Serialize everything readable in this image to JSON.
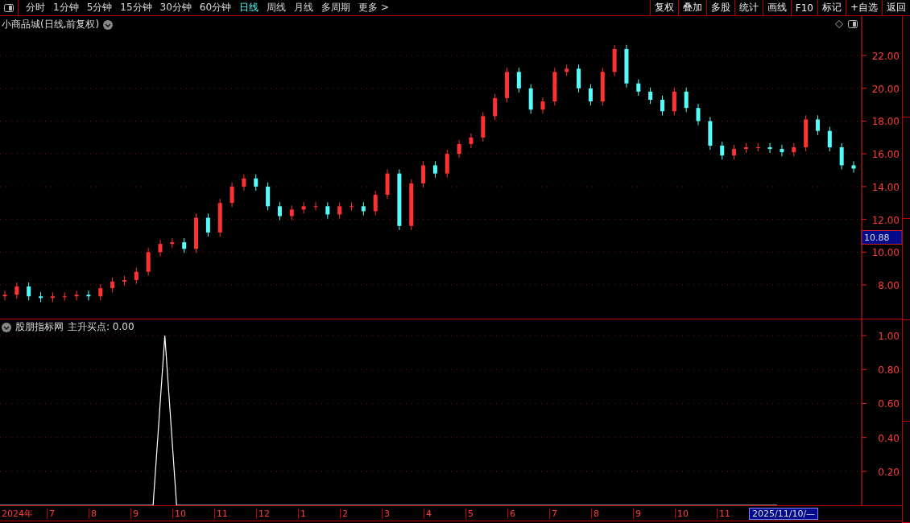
{
  "toolbar": {
    "periods": [
      {
        "label": "分时",
        "selected": false
      },
      {
        "label": "1分钟",
        "selected": false
      },
      {
        "label": "5分钟",
        "selected": false
      },
      {
        "label": "15分钟",
        "selected": false
      },
      {
        "label": "30分钟",
        "selected": false
      },
      {
        "label": "60分钟",
        "selected": false
      },
      {
        "label": "日线",
        "selected": true
      },
      {
        "label": "周线",
        "selected": false
      },
      {
        "label": "月线",
        "selected": false
      },
      {
        "label": "多周期",
        "selected": false
      },
      {
        "label": "更多 >",
        "selected": false
      }
    ],
    "buttons": [
      "复权",
      "叠加",
      "多股",
      "统计",
      "画线",
      "F10",
      "标记",
      "+自选",
      "返回"
    ]
  },
  "price_panel": {
    "title": "小商品城(日线,前复权)",
    "cursor_price": "10.88",
    "chart_data": {
      "type": "candlestick",
      "grid": true,
      "ylim": [
        5.94,
        24.41
      ],
      "yticks": [
        {
          "value": 8,
          "label": "8.00"
        },
        {
          "value": 10,
          "label": "10.00"
        },
        {
          "value": 12,
          "label": "12.00"
        },
        {
          "value": 14,
          "label": "14.00"
        },
        {
          "value": 16,
          "label": "16.00"
        },
        {
          "value": 18,
          "label": "18.00"
        },
        {
          "value": 20,
          "label": "20.00"
        },
        {
          "value": 22,
          "label": "22.00"
        }
      ],
      "ohlc": [
        [
          7.3,
          7.65,
          7.05,
          7.4
        ],
        [
          7.4,
          8.15,
          7.15,
          7.9
        ],
        [
          7.9,
          8.15,
          7.05,
          7.3
        ],
        [
          7.3,
          7.55,
          6.95,
          7.2
        ],
        [
          7.2,
          7.55,
          6.95,
          7.3
        ],
        [
          7.3,
          7.55,
          7.05,
          7.3
        ],
        [
          7.3,
          7.65,
          7.05,
          7.4
        ],
        [
          7.4,
          7.65,
          7.05,
          7.3
        ],
        [
          7.3,
          8.05,
          7.05,
          7.8
        ],
        [
          7.8,
          8.45,
          7.55,
          8.2
        ],
        [
          8.2,
          8.55,
          7.95,
          8.3
        ],
        [
          8.3,
          9.05,
          8.05,
          8.8
        ],
        [
          8.8,
          10.25,
          8.55,
          10.0
        ],
        [
          10.0,
          10.75,
          9.75,
          10.5
        ],
        [
          10.5,
          10.85,
          10.25,
          10.6
        ],
        [
          10.6,
          10.85,
          9.95,
          10.2
        ],
        [
          10.2,
          12.35,
          9.95,
          12.1
        ],
        [
          12.1,
          12.35,
          10.95,
          11.2
        ],
        [
          11.2,
          13.25,
          10.95,
          13.0
        ],
        [
          13.0,
          14.25,
          12.75,
          14.0
        ],
        [
          14.0,
          14.75,
          13.75,
          14.5
        ],
        [
          14.5,
          14.75,
          13.75,
          14.0
        ],
        [
          14.0,
          14.25,
          12.55,
          12.8
        ],
        [
          12.8,
          13.05,
          11.95,
          12.2
        ],
        [
          12.2,
          12.85,
          11.95,
          12.6
        ],
        [
          12.6,
          13.05,
          12.35,
          12.8
        ],
        [
          12.8,
          13.05,
          12.55,
          12.8
        ],
        [
          12.8,
          13.05,
          12.05,
          12.3
        ],
        [
          12.3,
          13.05,
          12.05,
          12.8
        ],
        [
          12.8,
          13.05,
          12.55,
          12.8
        ],
        [
          12.8,
          13.05,
          12.25,
          12.5
        ],
        [
          12.5,
          13.75,
          12.25,
          13.5
        ],
        [
          13.5,
          15.05,
          13.25,
          14.8
        ],
        [
          14.8,
          15.05,
          11.35,
          11.6
        ],
        [
          11.6,
          14.45,
          11.35,
          14.2
        ],
        [
          14.2,
          15.55,
          13.95,
          15.3
        ],
        [
          15.3,
          15.55,
          14.55,
          14.8
        ],
        [
          14.8,
          16.25,
          14.55,
          16.0
        ],
        [
          16.0,
          16.85,
          15.75,
          16.6
        ],
        [
          16.6,
          17.25,
          16.35,
          17.0
        ],
        [
          17.0,
          18.55,
          16.75,
          18.3
        ],
        [
          18.3,
          19.65,
          18.05,
          19.4
        ],
        [
          19.4,
          21.25,
          19.15,
          21.0
        ],
        [
          21.0,
          21.25,
          19.75,
          20.0
        ],
        [
          20.0,
          20.25,
          18.45,
          18.7
        ],
        [
          18.7,
          19.45,
          18.45,
          19.2
        ],
        [
          19.2,
          21.25,
          18.95,
          21.0
        ],
        [
          21.0,
          21.45,
          20.75,
          21.2
        ],
        [
          21.2,
          21.45,
          19.75,
          20.0
        ],
        [
          20.0,
          20.25,
          18.95,
          19.2
        ],
        [
          19.2,
          21.25,
          18.95,
          21.0
        ],
        [
          21.0,
          22.65,
          20.75,
          22.4
        ],
        [
          22.4,
          22.65,
          20.05,
          20.3
        ],
        [
          20.3,
          20.55,
          19.55,
          19.8
        ],
        [
          19.8,
          20.05,
          19.05,
          19.3
        ],
        [
          19.3,
          19.55,
          18.35,
          18.6
        ],
        [
          18.6,
          20.05,
          18.35,
          19.8
        ],
        [
          19.8,
          20.05,
          18.55,
          18.8
        ],
        [
          18.8,
          19.05,
          17.75,
          18.0
        ],
        [
          18.0,
          18.25,
          16.25,
          16.5
        ],
        [
          16.5,
          16.75,
          15.65,
          15.9
        ],
        [
          15.9,
          16.55,
          15.65,
          16.3
        ],
        [
          16.3,
          16.65,
          16.05,
          16.4
        ],
        [
          16.4,
          16.65,
          16.15,
          16.4
        ],
        [
          16.4,
          16.65,
          16.05,
          16.3
        ],
        [
          16.3,
          16.55,
          15.85,
          16.1
        ],
        [
          16.1,
          16.65,
          15.85,
          16.4
        ],
        [
          16.4,
          18.35,
          16.15,
          18.1
        ],
        [
          18.1,
          18.35,
          17.15,
          17.4
        ],
        [
          17.4,
          17.65,
          16.15,
          16.4
        ],
        [
          16.4,
          16.65,
          15.05,
          15.3
        ],
        [
          15.3,
          15.55,
          14.85,
          15.1
        ]
      ]
    }
  },
  "indicator_panel": {
    "source": "股朋指标网",
    "reading": "主升买点: 0.00",
    "chart_data": {
      "type": "line",
      "grid": true,
      "ylim": [
        0,
        1.1
      ],
      "yticks": [
        {
          "value": 0.2,
          "label": "0.20"
        },
        {
          "value": 0.4,
          "label": "0.40"
        },
        {
          "value": 0.6,
          "label": "0.60"
        },
        {
          "value": 0.8,
          "label": "0.80"
        },
        {
          "value": 1,
          "label": "1.00"
        }
      ],
      "series": [
        {
          "color": "#ffffff",
          "values": [
            0,
            0,
            0,
            0,
            0,
            0,
            0,
            0,
            0,
            0,
            0,
            0,
            0,
            0,
            1,
            0,
            0,
            0,
            0,
            0,
            0,
            0,
            0,
            0,
            0,
            0,
            0,
            0,
            0,
            0,
            0,
            0,
            0,
            0,
            0,
            0,
            0,
            0,
            0,
            0,
            0,
            0,
            0,
            0,
            0,
            0,
            0,
            0,
            0,
            0,
            0,
            0,
            0,
            0,
            0,
            0,
            0,
            0,
            0,
            0,
            0,
            0,
            0,
            0,
            0,
            0,
            0
          ]
        }
      ]
    }
  },
  "time_axis": {
    "labels": [
      "2024年",
      "7",
      "8",
      "9",
      "10",
      "11",
      "12",
      "1",
      "2",
      "3",
      "4",
      "5",
      "6",
      "7",
      "8",
      "9",
      "10",
      "11"
    ],
    "cursor_date": "2025/11/10/—"
  }
}
